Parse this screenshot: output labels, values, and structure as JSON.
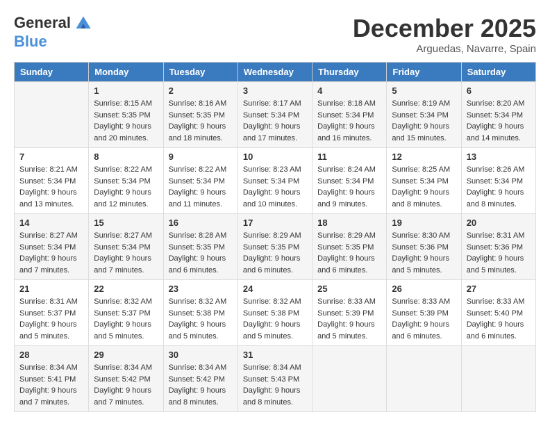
{
  "logo": {
    "general": "General",
    "blue": "Blue"
  },
  "header": {
    "month": "December 2025",
    "location": "Arguedas, Navarre, Spain"
  },
  "days_of_week": [
    "Sunday",
    "Monday",
    "Tuesday",
    "Wednesday",
    "Thursday",
    "Friday",
    "Saturday"
  ],
  "weeks": [
    [
      {
        "day": "",
        "info": ""
      },
      {
        "day": "1",
        "info": "Sunrise: 8:15 AM\nSunset: 5:35 PM\nDaylight: 9 hours\nand 20 minutes."
      },
      {
        "day": "2",
        "info": "Sunrise: 8:16 AM\nSunset: 5:35 PM\nDaylight: 9 hours\nand 18 minutes."
      },
      {
        "day": "3",
        "info": "Sunrise: 8:17 AM\nSunset: 5:34 PM\nDaylight: 9 hours\nand 17 minutes."
      },
      {
        "day": "4",
        "info": "Sunrise: 8:18 AM\nSunset: 5:34 PM\nDaylight: 9 hours\nand 16 minutes."
      },
      {
        "day": "5",
        "info": "Sunrise: 8:19 AM\nSunset: 5:34 PM\nDaylight: 9 hours\nand 15 minutes."
      },
      {
        "day": "6",
        "info": "Sunrise: 8:20 AM\nSunset: 5:34 PM\nDaylight: 9 hours\nand 14 minutes."
      }
    ],
    [
      {
        "day": "7",
        "info": "Sunrise: 8:21 AM\nSunset: 5:34 PM\nDaylight: 9 hours\nand 13 minutes."
      },
      {
        "day": "8",
        "info": "Sunrise: 8:22 AM\nSunset: 5:34 PM\nDaylight: 9 hours\nand 12 minutes."
      },
      {
        "day": "9",
        "info": "Sunrise: 8:22 AM\nSunset: 5:34 PM\nDaylight: 9 hours\nand 11 minutes."
      },
      {
        "day": "10",
        "info": "Sunrise: 8:23 AM\nSunset: 5:34 PM\nDaylight: 9 hours\nand 10 minutes."
      },
      {
        "day": "11",
        "info": "Sunrise: 8:24 AM\nSunset: 5:34 PM\nDaylight: 9 hours\nand 9 minutes."
      },
      {
        "day": "12",
        "info": "Sunrise: 8:25 AM\nSunset: 5:34 PM\nDaylight: 9 hours\nand 8 minutes."
      },
      {
        "day": "13",
        "info": "Sunrise: 8:26 AM\nSunset: 5:34 PM\nDaylight: 9 hours\nand 8 minutes."
      }
    ],
    [
      {
        "day": "14",
        "info": "Sunrise: 8:27 AM\nSunset: 5:34 PM\nDaylight: 9 hours\nand 7 minutes."
      },
      {
        "day": "15",
        "info": "Sunrise: 8:27 AM\nSunset: 5:34 PM\nDaylight: 9 hours\nand 7 minutes."
      },
      {
        "day": "16",
        "info": "Sunrise: 8:28 AM\nSunset: 5:35 PM\nDaylight: 9 hours\nand 6 minutes."
      },
      {
        "day": "17",
        "info": "Sunrise: 8:29 AM\nSunset: 5:35 PM\nDaylight: 9 hours\nand 6 minutes."
      },
      {
        "day": "18",
        "info": "Sunrise: 8:29 AM\nSunset: 5:35 PM\nDaylight: 9 hours\nand 6 minutes."
      },
      {
        "day": "19",
        "info": "Sunrise: 8:30 AM\nSunset: 5:36 PM\nDaylight: 9 hours\nand 5 minutes."
      },
      {
        "day": "20",
        "info": "Sunrise: 8:31 AM\nSunset: 5:36 PM\nDaylight: 9 hours\nand 5 minutes."
      }
    ],
    [
      {
        "day": "21",
        "info": "Sunrise: 8:31 AM\nSunset: 5:37 PM\nDaylight: 9 hours\nand 5 minutes."
      },
      {
        "day": "22",
        "info": "Sunrise: 8:32 AM\nSunset: 5:37 PM\nDaylight: 9 hours\nand 5 minutes."
      },
      {
        "day": "23",
        "info": "Sunrise: 8:32 AM\nSunset: 5:38 PM\nDaylight: 9 hours\nand 5 minutes."
      },
      {
        "day": "24",
        "info": "Sunrise: 8:32 AM\nSunset: 5:38 PM\nDaylight: 9 hours\nand 5 minutes."
      },
      {
        "day": "25",
        "info": "Sunrise: 8:33 AM\nSunset: 5:39 PM\nDaylight: 9 hours\nand 5 minutes."
      },
      {
        "day": "26",
        "info": "Sunrise: 8:33 AM\nSunset: 5:39 PM\nDaylight: 9 hours\nand 6 minutes."
      },
      {
        "day": "27",
        "info": "Sunrise: 8:33 AM\nSunset: 5:40 PM\nDaylight: 9 hours\nand 6 minutes."
      }
    ],
    [
      {
        "day": "28",
        "info": "Sunrise: 8:34 AM\nSunset: 5:41 PM\nDaylight: 9 hours\nand 7 minutes."
      },
      {
        "day": "29",
        "info": "Sunrise: 8:34 AM\nSunset: 5:42 PM\nDaylight: 9 hours\nand 7 minutes."
      },
      {
        "day": "30",
        "info": "Sunrise: 8:34 AM\nSunset: 5:42 PM\nDaylight: 9 hours\nand 8 minutes."
      },
      {
        "day": "31",
        "info": "Sunrise: 8:34 AM\nSunset: 5:43 PM\nDaylight: 9 hours\nand 8 minutes."
      },
      {
        "day": "",
        "info": ""
      },
      {
        "day": "",
        "info": ""
      },
      {
        "day": "",
        "info": ""
      }
    ]
  ]
}
